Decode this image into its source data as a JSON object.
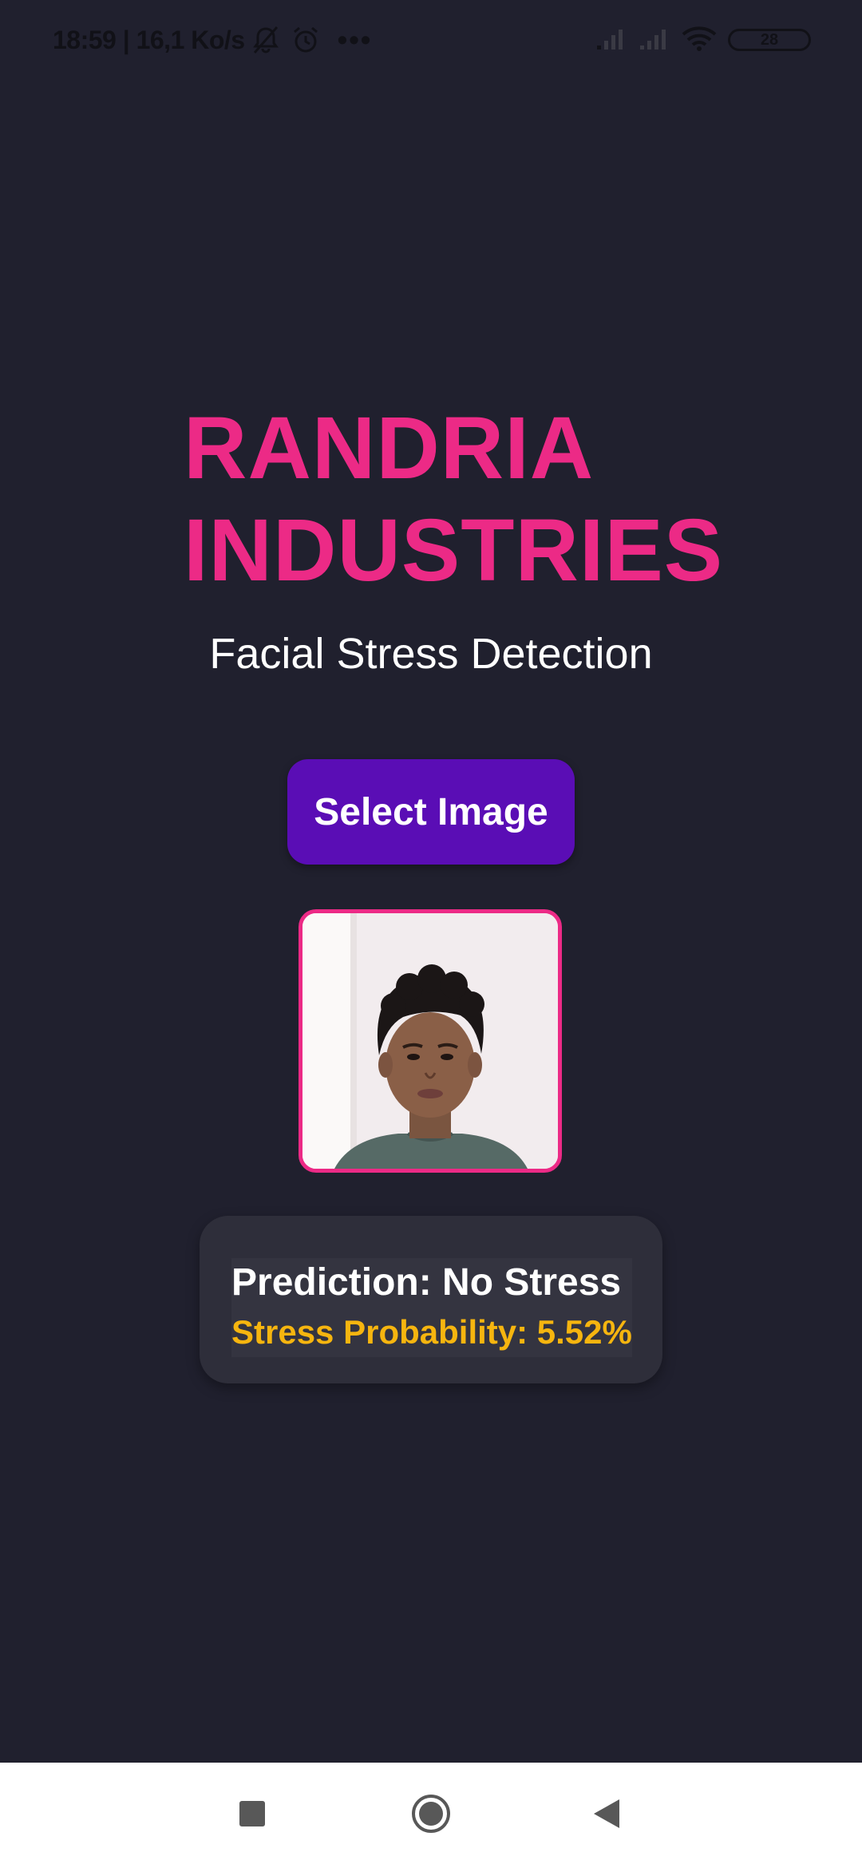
{
  "status_bar": {
    "time_speed": "18:59 | 16,1 Ko/s",
    "battery": "28",
    "icons": [
      "bell-off-icon",
      "alarm-icon",
      "more-dots-icon",
      "signal-icon",
      "signal-icon",
      "wifi-icon",
      "battery-icon"
    ]
  },
  "app": {
    "brand_line1": "RANDRIA",
    "brand_line2": "INDUSTRIES",
    "subtitle": "Facial Stress Detection",
    "select_button_label": "Select Image",
    "result": {
      "prediction": "Prediction: No Stress",
      "probability": "Stress Probability: 5.52%"
    }
  },
  "nav_bar": {
    "icons": [
      "recent-apps-icon",
      "home-icon",
      "back-icon"
    ]
  },
  "colors": {
    "background": "#20202e",
    "brand": "#ec2a86",
    "button": "#5a0db5",
    "card": "#2e2e3a",
    "probability": "#f6b50f"
  }
}
